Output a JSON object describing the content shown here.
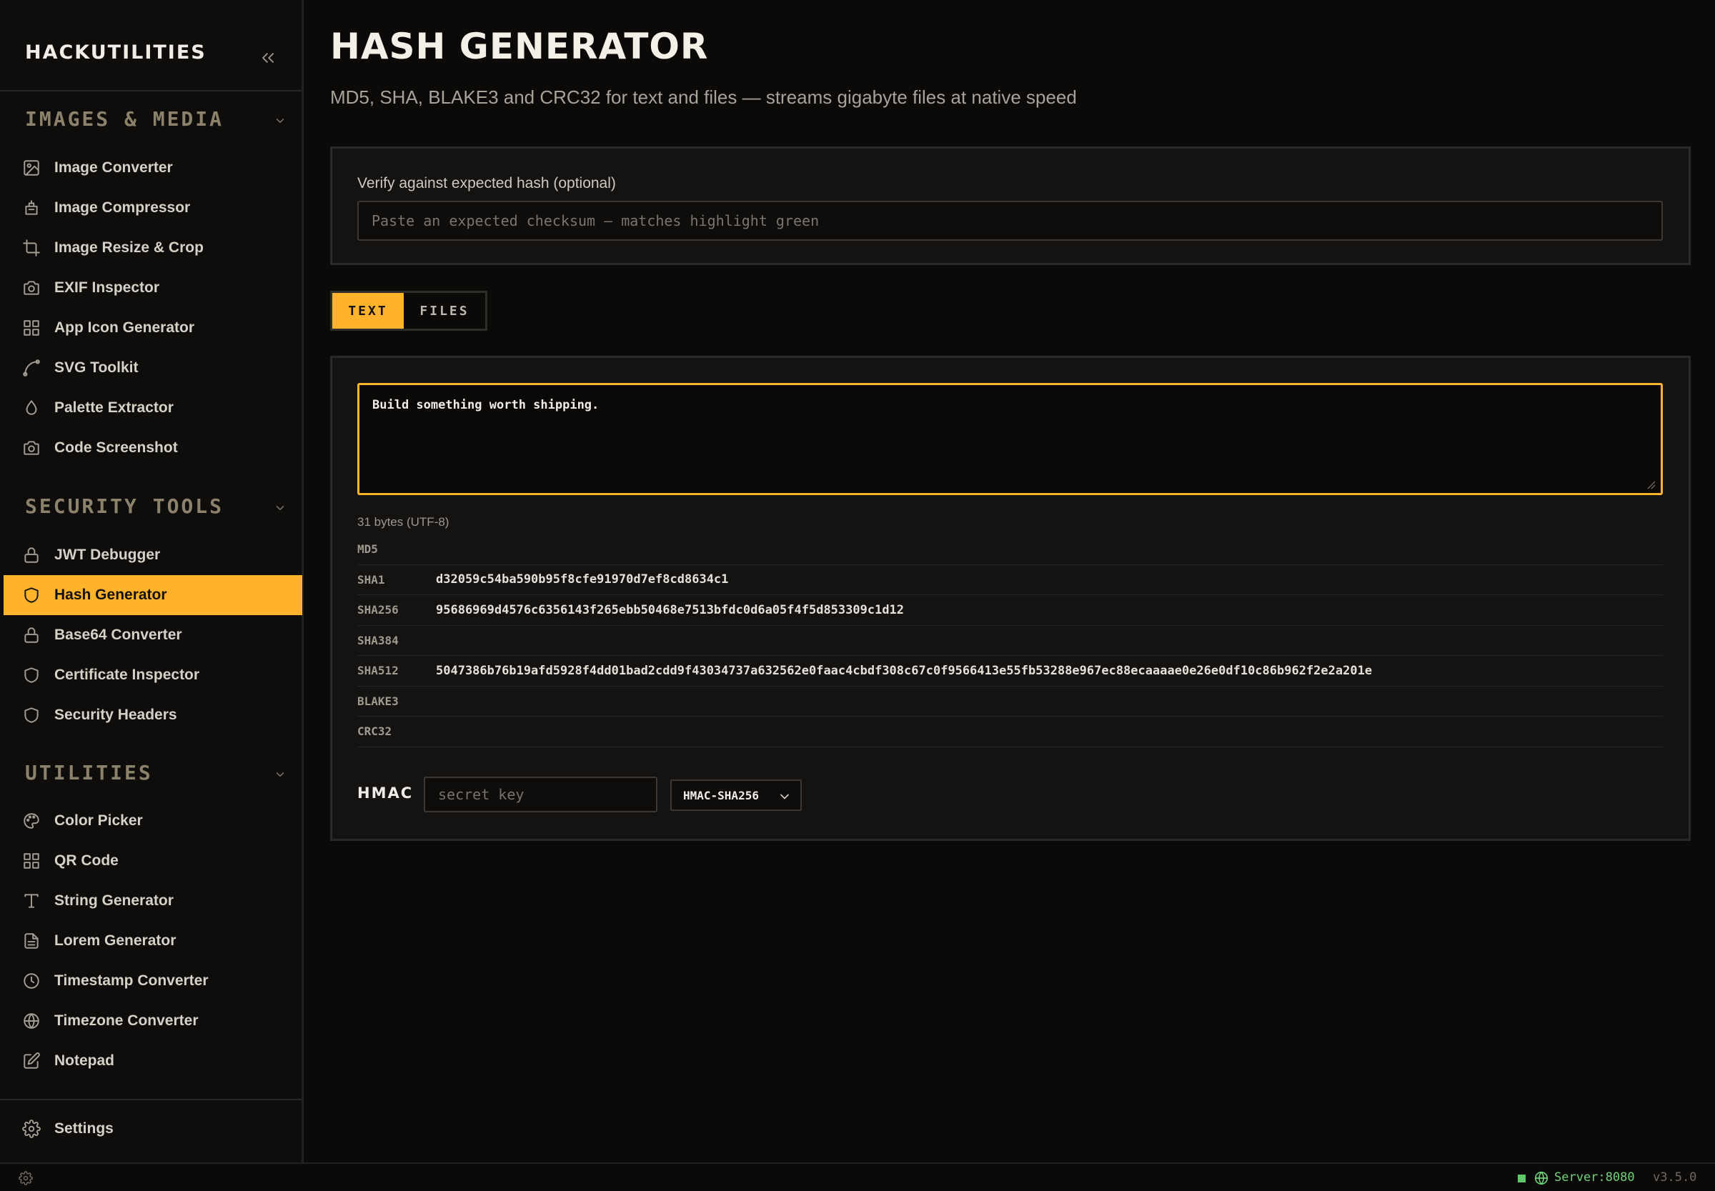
{
  "app": {
    "name": "HACKUTILITIES"
  },
  "sidebar": {
    "sections": [
      {
        "title": "IMAGES & MEDIA",
        "items": [
          {
            "label": "Image Converter",
            "icon": "image-icon"
          },
          {
            "label": "Image Compressor",
            "icon": "compress-icon"
          },
          {
            "label": "Image Resize & Crop",
            "icon": "crop-icon"
          },
          {
            "label": "EXIF Inspector",
            "icon": "camera-icon"
          },
          {
            "label": "App Icon Generator",
            "icon": "grid-icon"
          },
          {
            "label": "SVG Toolkit",
            "icon": "bezier-icon"
          },
          {
            "label": "Palette Extractor",
            "icon": "droplet-icon"
          },
          {
            "label": "Code Screenshot",
            "icon": "camera-icon"
          }
        ]
      },
      {
        "title": "SECURITY TOOLS",
        "items": [
          {
            "label": "JWT Debugger",
            "icon": "lock-icon"
          },
          {
            "label": "Hash Generator",
            "icon": "shield-icon",
            "active": true
          },
          {
            "label": "Base64 Converter",
            "icon": "lock-icon"
          },
          {
            "label": "Certificate Inspector",
            "icon": "shield-icon"
          },
          {
            "label": "Security Headers",
            "icon": "shield-icon"
          }
        ]
      },
      {
        "title": "UTILITIES",
        "items": [
          {
            "label": "Color Picker",
            "icon": "palette-icon"
          },
          {
            "label": "QR Code",
            "icon": "grid-icon"
          },
          {
            "label": "String Generator",
            "icon": "type-icon"
          },
          {
            "label": "Lorem Generator",
            "icon": "document-icon"
          },
          {
            "label": "Timestamp Converter",
            "icon": "clock-icon"
          },
          {
            "label": "Timezone Converter",
            "icon": "globe-icon"
          },
          {
            "label": "Notepad",
            "icon": "edit-icon"
          }
        ]
      }
    ],
    "settings_label": "Settings"
  },
  "page": {
    "title": "HASH GENERATOR",
    "subtitle": "MD5, SHA, BLAKE3 and CRC32 for text and files — streams gigabyte files at native speed"
  },
  "verify": {
    "label": "Verify against expected hash (optional)",
    "placeholder": "Paste an expected checksum — matches highlight green",
    "value": ""
  },
  "tabs": [
    {
      "label": "TEXT",
      "active": true
    },
    {
      "label": "FILES",
      "active": false
    }
  ],
  "input": {
    "text": "Build something worth shipping.",
    "bytes_info": "31 bytes (UTF-8)"
  },
  "hashes": [
    {
      "algo": "MD5",
      "value": ""
    },
    {
      "algo": "SHA1",
      "value": "d32059c54ba590b95f8cfe91970d7ef8cd8634c1"
    },
    {
      "algo": "SHA256",
      "value": "95686969d4576c6356143f265ebb50468e7513bfdc0d6a05f4f5d853309c1d12"
    },
    {
      "algo": "SHA384",
      "value": ""
    },
    {
      "algo": "SHA512",
      "value": "5047386b76b19afd5928f4dd01bad2cdd9f43034737a632562e0faac4cbdf308c67c0f9566413e55fb53288e967ec88ecaaaae0e26e0df10c86b962f2e2a201e"
    },
    {
      "algo": "BLAKE3",
      "value": ""
    },
    {
      "algo": "CRC32",
      "value": ""
    }
  ],
  "hmac": {
    "label": "HMAC",
    "key_placeholder": "secret key",
    "key_value": "",
    "algorithm": "HMAC-SHA256"
  },
  "status": {
    "server": "Server:8080",
    "version": "v3.5.0",
    "server_color": "#6fd17a"
  },
  "colors": {
    "accent": "#ffb22c",
    "background": "#0b0a09",
    "panel": "#141312"
  }
}
